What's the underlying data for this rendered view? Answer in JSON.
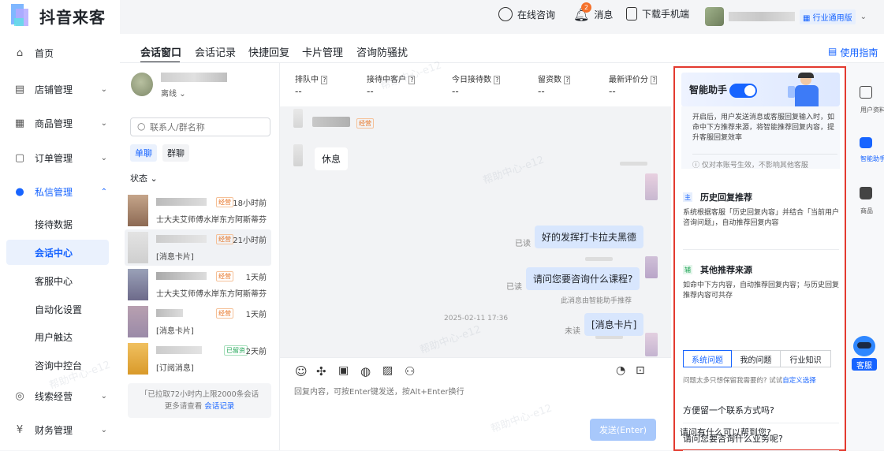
{
  "app": {
    "title": "抖音来客"
  },
  "sidebar": {
    "items": [
      {
        "label": "首页"
      },
      {
        "label": "店铺管理"
      },
      {
        "label": "商品管理"
      },
      {
        "label": "订单管理"
      },
      {
        "label": "私信管理"
      },
      {
        "label": "线索经营"
      },
      {
        "label": "财务管理"
      }
    ],
    "sub": [
      "接待数据",
      "会话中心",
      "客服中心",
      "自动化设置",
      "用户触达",
      "咨询中控台"
    ]
  },
  "topbar": {
    "consult": "在线咨询",
    "messages": "消息",
    "message_count": "2",
    "download": "下载手机端",
    "edition": "行业通用版"
  },
  "tabs": [
    "会话窗口",
    "会话记录",
    "快捷回复",
    "卡片管理",
    "咨询防骚扰"
  ],
  "guide_link": "使用指南",
  "agent": {
    "status": "离线"
  },
  "search": {
    "placeholder": "联系人/群名称"
  },
  "chat_type": {
    "single": "单聊",
    "group": "群聊"
  },
  "status_filter": "状态",
  "conversations": [
    {
      "badge": "经营",
      "time": "18小时前",
      "preview": "士大夫艾师傅水岸东方阿斯蒂芬"
    },
    {
      "badge": "经营",
      "time": "21小时前",
      "preview": "[消息卡片]"
    },
    {
      "badge": "经营",
      "time": "1天前",
      "preview": "士大夫艾师傅水岸东方阿斯蒂芬"
    },
    {
      "badge": "经营",
      "time": "1天前",
      "preview": "[消息卡片]"
    },
    {
      "badge": "已留资",
      "time": "2天前",
      "preview": "[订阅消息]"
    }
  ],
  "list_footer": {
    "text": "「已拉取72小时内上限2000条会话",
    "more_prefix": "更多请查看",
    "link": "会话记录"
  },
  "stats": [
    {
      "label": "排队中",
      "value": "--"
    },
    {
      "label": "接待中客户",
      "value": "--"
    },
    {
      "label": "今日接待数",
      "value": "--"
    },
    {
      "label": "留资数",
      "value": "--"
    },
    {
      "label": "最新评价分",
      "value": "--"
    }
  ],
  "chat": {
    "in_badge": "经营",
    "in_message": "休息",
    "out1": {
      "status": "已读",
      "text": "好的发挥打卡拉夫黑德"
    },
    "out2": {
      "status": "已读",
      "text": "请问您要咨询什么课程?"
    },
    "assistant_note": "此消息由智能助手推荐",
    "timestamp": "2025-02-11 17:36",
    "out3": {
      "status": "未读",
      "text": "[消息卡片]"
    },
    "input_placeholder": "回复内容，可按Enter键发送，按Alt+Enter换行",
    "send_label": "发送(Enter)"
  },
  "assistant": {
    "title": "智能助手",
    "enabled": true,
    "desc": "开启后，用户发送消息或客服回复输入时，如命中下方推荐来源，将智能推荐回复内容，提升客服回复效率",
    "note": "仅对本账号生效，不影响其他客服",
    "history": {
      "tag": "主",
      "title": "历史回复推荐",
      "desc": "系统根据客服「历史回复内容」并结合「当前用户咨询问题」，自动推荐回复内容"
    },
    "other": {
      "tag": "辅",
      "title": "其他推荐来源",
      "desc": "如命中下方内容，自动推荐回复内容；与历史回复推荐内容可共存"
    },
    "segments": [
      "系统问题",
      "我的问题",
      "行业知识"
    ],
    "hint": "问题太多只想保留我需要的? 试试",
    "hint_link": "自定义选择",
    "questions": [
      "方便留一个联系方式吗?",
      "请问您要咨询什么业务呢?",
      "请问有什么可以帮到您?"
    ]
  },
  "rightbar": {
    "user_info": "用户资料",
    "assistant": "智能助手",
    "product": "商品"
  },
  "service_label": "客服",
  "watermark": "帮助中心-e12",
  "colors": {
    "brand": "#1764ff",
    "highlight": "#e33a2f",
    "bubble": "#d8e6fd"
  }
}
